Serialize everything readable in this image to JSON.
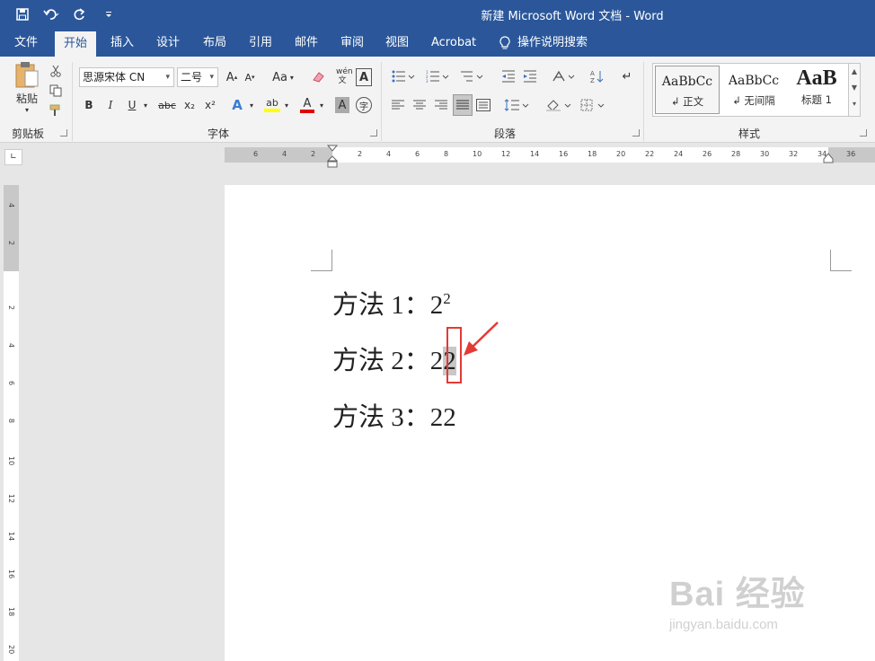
{
  "window": {
    "title": "新建 Microsoft Word 文档 - Word"
  },
  "tabs": [
    {
      "label": "文件"
    },
    {
      "label": "开始"
    },
    {
      "label": "插入"
    },
    {
      "label": "设计"
    },
    {
      "label": "布局"
    },
    {
      "label": "引用"
    },
    {
      "label": "邮件"
    },
    {
      "label": "审阅"
    },
    {
      "label": "视图"
    },
    {
      "label": "Acrobat"
    },
    {
      "label": "操作说明搜索"
    }
  ],
  "ribbon": {
    "clipboard": {
      "paste_label": "粘贴",
      "group_label": "剪贴板"
    },
    "font": {
      "font_name": "思源宋体 CN",
      "font_size": "二号",
      "group_label": "字体",
      "change_case_label": "Aa",
      "bold": "B",
      "italic": "I",
      "underline": "U",
      "strike": "abc",
      "subscript": "x₂",
      "superscript": "x²",
      "text_effects": "A",
      "highlight": "ab",
      "font_color": "A",
      "char_shading": "A",
      "enclose": "字",
      "pinyin": "wén 文"
    },
    "paragraph": {
      "group_label": "段落"
    },
    "styles": {
      "group_label": "样式",
      "items": [
        {
          "sample": "AaBbCc",
          "name": "↲ 正文"
        },
        {
          "sample": "AaBbCc",
          "name": "↲ 无间隔"
        },
        {
          "sample": "AaB",
          "name": "标题 1"
        }
      ]
    }
  },
  "ruler": {
    "h_labels": [
      "6",
      "4",
      "2",
      "2",
      "4",
      "6",
      "8",
      "10",
      "12",
      "14",
      "16",
      "18",
      "20",
      "22",
      "24",
      "26",
      "28",
      "30",
      "32",
      "34",
      "36"
    ],
    "v_labels": [
      "4",
      "2",
      "2",
      "4",
      "6",
      "8",
      "10",
      "12",
      "14",
      "16",
      "18",
      "20"
    ]
  },
  "document": {
    "lines": [
      {
        "prefix": "方法 1：",
        "base": "2",
        "sup": "2"
      },
      {
        "prefix": "方法 2：",
        "base": "2",
        "selected": "2"
      },
      {
        "prefix": "方法 3：",
        "text": "22"
      }
    ]
  },
  "watermark": {
    "logo": "Bai 经验",
    "url": "jingyan.baidu.com"
  },
  "colors": {
    "accent": "#2b579a",
    "annotation": "#e53935"
  }
}
